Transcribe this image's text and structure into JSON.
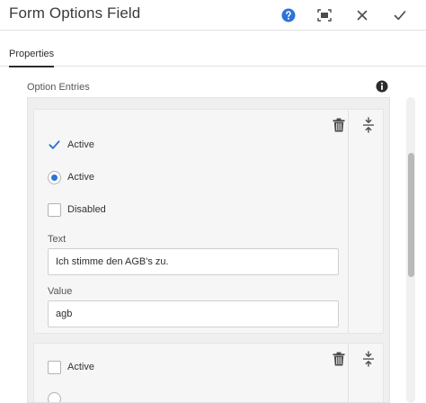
{
  "header": {
    "title": "Form Options Field",
    "icons": [
      "help-icon",
      "fullscreen-icon",
      "close-icon",
      "checkmark-icon"
    ]
  },
  "tabs": [
    {
      "label": "Properties",
      "active": true
    }
  ],
  "section": {
    "label": "Option Entries",
    "info_icon": "info-icon"
  },
  "entries": [
    {
      "checkbox_label": "Active",
      "checkbox_checked": true,
      "radio_label": "Active",
      "radio_selected": true,
      "disabled_label": "Disabled",
      "disabled_checked": false,
      "text_label": "Text",
      "text_value": "Ich stimme den AGB's zu.",
      "value_label": "Value",
      "value_value": "agb"
    },
    {
      "checkbox_label": "Active",
      "checkbox_checked": false
    }
  ],
  "colors": {
    "accent": "#2d72d9",
    "icon": "#4b4b4b",
    "border": "#e3e3e3"
  }
}
